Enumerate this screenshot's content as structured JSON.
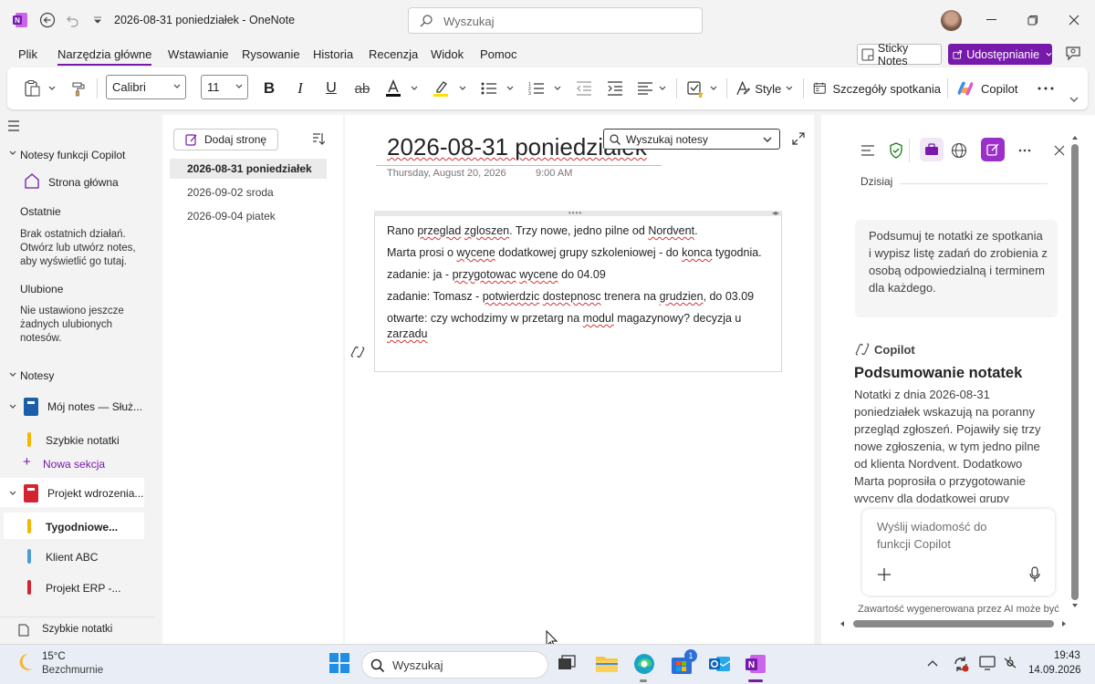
{
  "titlebar": {
    "doc_title": "2026-08-31 poniedziałek  -  OneNote",
    "search_placeholder": "Wyszukaj"
  },
  "ribbon_tabs": [
    "Plik",
    "Narzędzia główne",
    "Wstawianie",
    "Rysowanie",
    "Historia",
    "Recenzja",
    "Widok",
    "Pomoc"
  ],
  "ribbon_actions": {
    "sticky_notes": "Sticky Notes",
    "share": "Udostępnianie"
  },
  "ribbon": {
    "font_name": "Calibri",
    "font_size": "11",
    "style_label": "Style",
    "meeting_details": "Szczegóły spotkania",
    "copilot": "Copilot",
    "accent_color": "#7719aa"
  },
  "leftnav": {
    "copilot_notebooks": "Notesy funkcji Copilot",
    "home": "Strona główna",
    "recent_heading": "Ostatnie",
    "recent_empty": "Brak ostatnich działań. Otwórz lub utwórz notes, aby wyświetlić go tutaj.",
    "favorites_heading": "Ulubione",
    "favorites_empty": "Nie ustawiono jeszcze żadnych ulubionych notesów.",
    "notebooks_heading": "Notesy",
    "notebooks": [
      {
        "name": "Mój notes — Służ...",
        "color": "#1a5fa8"
      },
      {
        "name": "Projekt wdrozenia...",
        "color": "#d32432"
      }
    ],
    "sections_nb1": [
      {
        "name": "Szybkie notatki",
        "color": "#f7b500"
      }
    ],
    "new_section": "Nowa sekcja",
    "sections_nb2": [
      {
        "name": "Tygodniowe...",
        "color": "#f7b500"
      },
      {
        "name": "Klient ABC",
        "color": "#4f9bd9"
      },
      {
        "name": "Projekt ERP -...",
        "color": "#d32432"
      }
    ],
    "quick_notes": "Szybkie notatki"
  },
  "pagelist": {
    "add_page": "Dodaj stronę",
    "pages": [
      "2026-08-31 poniedziałek",
      "2026-09-02 sroda",
      "2026-09-04 piatek"
    ]
  },
  "page": {
    "title": "2026-08-31 poniedziałek",
    "date": "Thursday, August 20, 2026",
    "time": "9:00 AM",
    "notebook_search": "Wyszukaj notesy"
  },
  "note": {
    "l1_a": "Rano ",
    "l1_b": "przeglad",
    "l1_c": " ",
    "l1_d": "zgloszen",
    "l1_e": ". Trzy nowe, jedno pilne od ",
    "l1_f": "Nordvent",
    "l1_g": ".",
    "l2_a": "Marta prosi o ",
    "l2_b": "wycene",
    "l2_c": " dodatkowej grupy szkoleniowej - do ",
    "l2_d": "konca",
    "l2_e": " tygodnia.",
    "l3_a": "zadanie: ja - ",
    "l3_b": "przygotowac",
    "l3_c": " ",
    "l3_d": "wycene",
    "l3_e": " do 04.09",
    "l4_a": "zadanie: Tomasz - ",
    "l4_b": "potwierdzic",
    "l4_c": " ",
    "l4_d": "dostepnosc",
    "l4_e": " trenera na ",
    "l4_f": "grudzien",
    "l4_g": ", do 03.09",
    "l5_a": "otwarte: czy wchodzimy w przetarg na ",
    "l5_b": "modul",
    "l5_c": " magazynowy? decyzja u",
    "l6_a": "zarzadu"
  },
  "copilot_pane": {
    "today": "Dzisiaj",
    "user_prompt": "Podsumuj te notatki ze spotkania i wypisz listę zadań do zrobienia z osobą odpowiedzialną i terminem dla każdego.",
    "label": "Copilot",
    "heading": "Podsumowanie notatek",
    "response": "Notatki z dnia 2026-08-31 poniedziałek wskazują na poranny przegląd zgłoszeń. Pojawiły się trzy nowe zgłoszenia, w tym jedno pilne od klienta Nordvent. Dodatkowo Marta poprosiła o przygotowanie wyceny dla dodatkowej grupy",
    "composer_placeholder": "Wyślij wiadomość do funkcji Copilot",
    "disclaimer": "Zawartość wygenerowana przez AI może być"
  },
  "taskbar": {
    "temp": "15°C",
    "weather": "Bezchmurnie",
    "search": "Wyszukaj",
    "store_badge": "1",
    "time": "19:43",
    "date": "14.09.2026"
  }
}
